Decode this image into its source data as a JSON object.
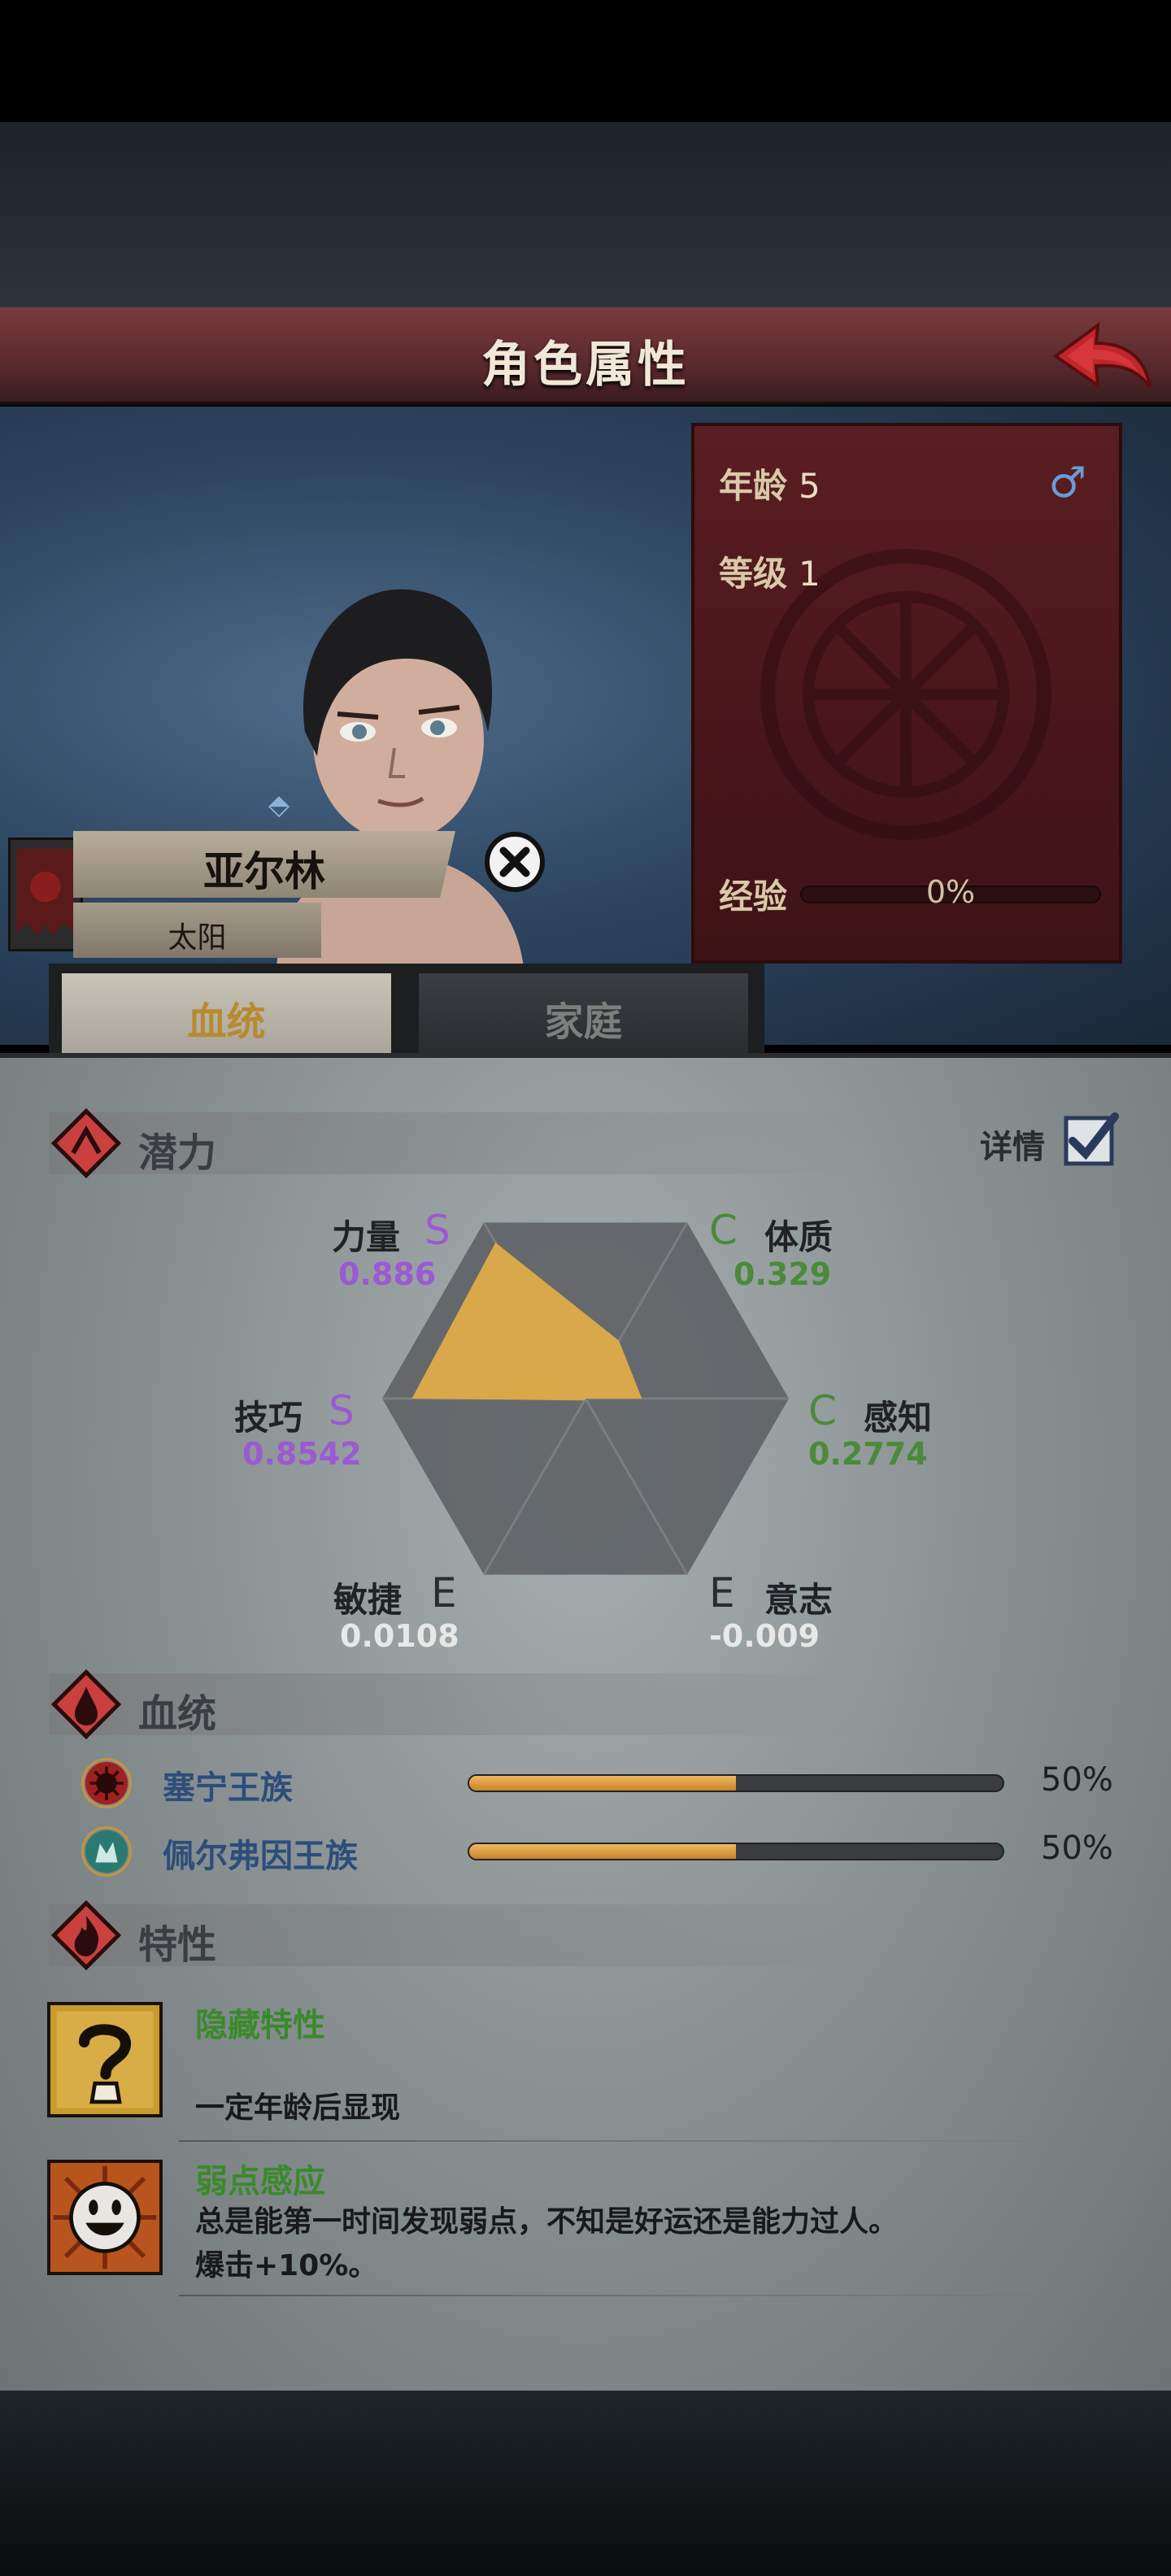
{
  "header": {
    "title": "角色属性"
  },
  "character": {
    "name": "亚尔林",
    "title": "太阳",
    "age_label": "年龄",
    "age": "5",
    "level_label": "等级",
    "level": "1",
    "exp_label": "经验",
    "exp_text": "0%",
    "exp_progress": 0
  },
  "tabs": [
    {
      "label": "血统",
      "active": true
    },
    {
      "label": "家庭",
      "active": false
    }
  ],
  "potential": {
    "title": "潜力",
    "details_label": "详情",
    "details_checked": true,
    "attributes": [
      {
        "name": "力量",
        "grade": "S",
        "value": "0.886"
      },
      {
        "name": "体质",
        "grade": "C",
        "value": "0.329"
      },
      {
        "name": "感知",
        "grade": "C",
        "value": "0.2774"
      },
      {
        "name": "意志",
        "grade": "E",
        "value": "-0.009"
      },
      {
        "name": "敏捷",
        "grade": "E",
        "value": "0.0108"
      },
      {
        "name": "技巧",
        "grade": "S",
        "value": "0.8542"
      }
    ]
  },
  "bloodline": {
    "title": "血统",
    "rows": [
      {
        "name": "塞宁王族",
        "percent_text": "50%",
        "percent": 50
      },
      {
        "name": "佩尔弗因王族",
        "percent_text": "50%",
        "percent": 50
      }
    ]
  },
  "traits": {
    "title": "特性",
    "items": [
      {
        "name": "隐藏特性",
        "desc_lines": [
          "一定年龄后显现"
        ],
        "icon": "question-mark-icon"
      },
      {
        "name": "弱点感应",
        "desc_lines": [
          "总是能第一时间发现弱点，不知是好运还是能力过人。",
          "爆击+10%。"
        ],
        "icon": "grin-face-icon"
      }
    ]
  },
  "colors": {
    "grade_S": "#9a5ad2",
    "grade_C": "#4a8a3a",
    "grade_E": "#2a2c30",
    "radar_fill": "#d9a84a",
    "accent_red": "#7a3a3d"
  }
}
